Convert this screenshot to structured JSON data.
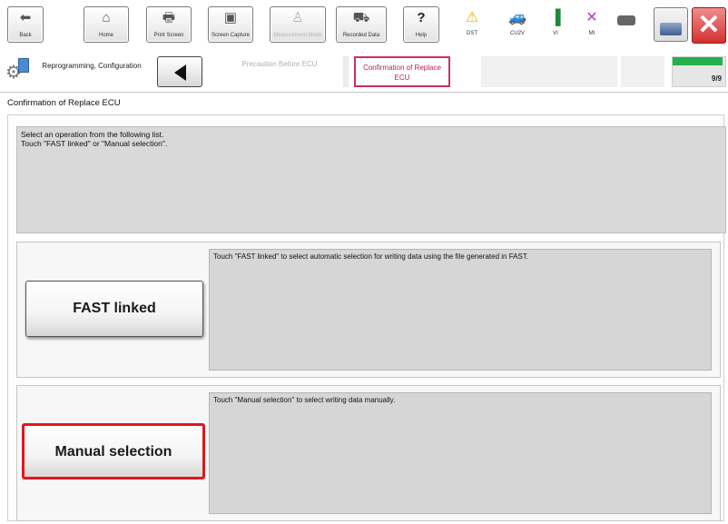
{
  "toolbar": {
    "buttons": [
      {
        "label": "Back",
        "glyph": "⬅",
        "icon": "back-arrow-icon",
        "disabled": false
      },
      {
        "label": "Home",
        "glyph": "⌂",
        "icon": "home-icon",
        "disabled": false
      },
      {
        "label": "Print Screen",
        "glyph": "🖶",
        "icon": "printer-icon",
        "disabled": false
      },
      {
        "label": "Screen Capture",
        "glyph": "▣",
        "icon": "camera-icon",
        "disabled": false
      },
      {
        "label": "Measurement Mode",
        "glyph": "♙",
        "icon": "measurement-icon",
        "disabled": true
      },
      {
        "label": "Recorded Data",
        "glyph": "⛟",
        "icon": "recorded-data-icon",
        "disabled": false
      },
      {
        "label": "Help",
        "glyph": "?",
        "icon": "help-icon",
        "disabled": false
      }
    ],
    "status": [
      {
        "label": "DST",
        "glyph": "⚠",
        "icon": "warning-icon",
        "color": "#e8b400"
      },
      {
        "label": "CU2V",
        "glyph": "🚙",
        "icon": "car-icon",
        "color": "#2b87d4"
      },
      {
        "label": "VI",
        "glyph": "▐",
        "icon": "signal-icon",
        "color": "#1f8a3a"
      },
      {
        "label": "MI",
        "glyph": "✕",
        "icon": "mi-cross-icon",
        "color": "#b33cc4"
      }
    ],
    "close_glyph": "✕"
  },
  "breadcrumb": {
    "section": "Reprogramming, Configuration",
    "previous": "Precaution Before ECU",
    "current": "Confirmation of Replace ECU",
    "step": "9/9",
    "progress_fraction": 0.95
  },
  "page": {
    "title": "Confirmation of Replace ECU",
    "instruction": "Select an operation from the following list.\nTouch \"FAST linked\" or \"Manual selection\"."
  },
  "options": [
    {
      "button": "FAST linked",
      "description": "Touch \"FAST linked\" to select automatic selection for writing data using the file generated in FAST."
    },
    {
      "button": "Manual selection",
      "description": "Touch \"Manual selection\" to select writing data manually."
    }
  ],
  "colors": {
    "highlight": "#e0171c",
    "current_step": "#c9325e",
    "progress": "#22b14c"
  }
}
